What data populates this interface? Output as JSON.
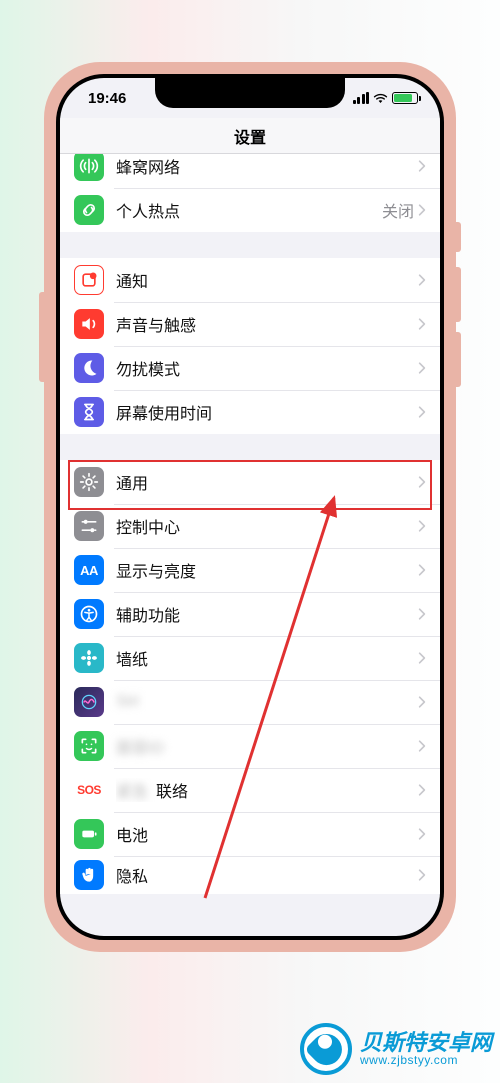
{
  "status": {
    "time": "19:46"
  },
  "nav": {
    "title": "设置"
  },
  "group1": {
    "cellular": {
      "label": "蜂窝网络"
    },
    "hotspot": {
      "label": "个人热点",
      "value": "关闭"
    }
  },
  "group2": {
    "notifications": {
      "label": "通知"
    },
    "sounds": {
      "label": "声音与触感"
    },
    "dnd": {
      "label": "勿扰模式"
    },
    "screentime": {
      "label": "屏幕使用时间"
    }
  },
  "group3": {
    "general": {
      "label": "通用"
    },
    "control": {
      "label": "控制中心"
    },
    "display": {
      "label": "显示与亮度",
      "iconText": "AA"
    },
    "accessibility": {
      "label": "辅助功能"
    },
    "wallpaper": {
      "label": "墙纸"
    },
    "siri": {
      "label": "Siri"
    },
    "faceid": {
      "label": "面容ID"
    },
    "sos": {
      "label": "紧急联络",
      "iconText": "SOS"
    },
    "battery": {
      "label": "电池"
    },
    "privacy": {
      "label": "隐私"
    }
  },
  "annotation": {
    "highlight_target": "general"
  },
  "watermark": {
    "title": "贝斯特安卓网",
    "url": "www.zjbstyy.com"
  }
}
